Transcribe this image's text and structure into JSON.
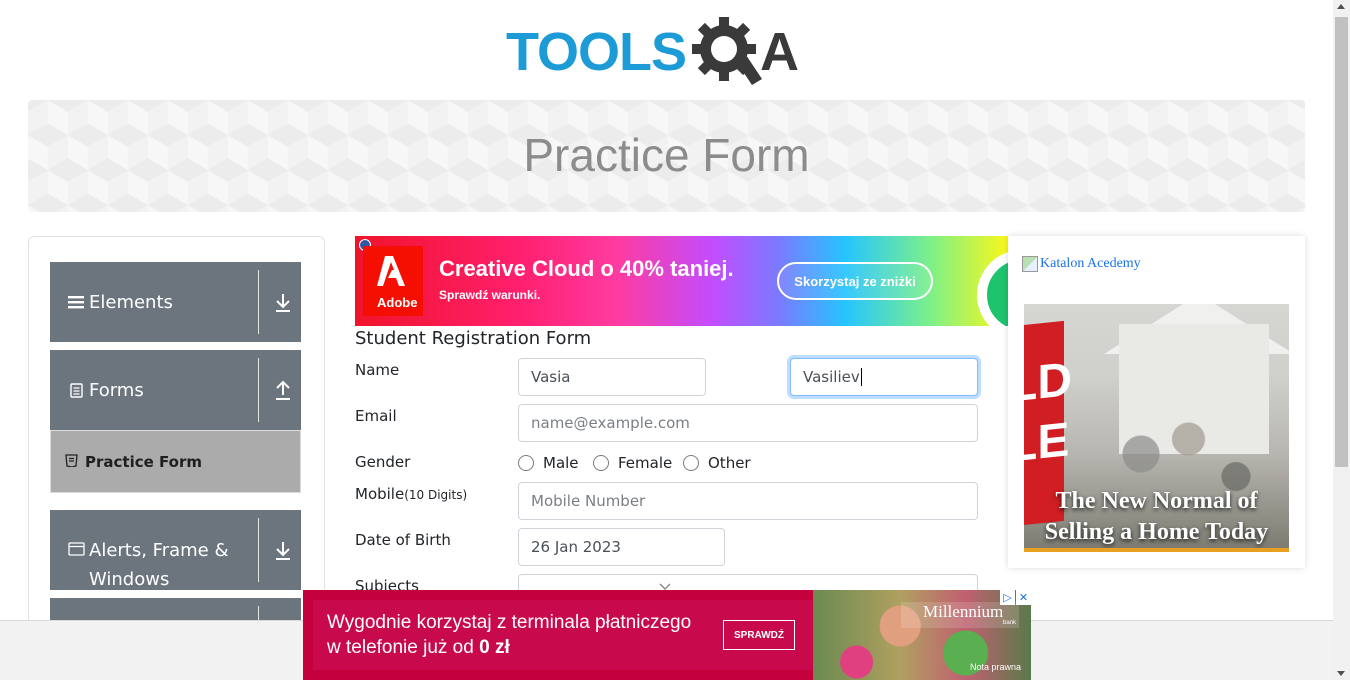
{
  "header": {
    "logo_text_left": "TOOLS",
    "logo_text_right": "A",
    "page_title": "Practice Form"
  },
  "sidebar": {
    "groups": [
      {
        "label": "Elements",
        "state": "collapsed"
      },
      {
        "label": "Forms",
        "state": "expanded"
      },
      {
        "label": "Alerts, Frame & Windows",
        "state": "collapsed"
      }
    ],
    "active_item": "Practice Form"
  },
  "ad_top": {
    "brand": "Adobe",
    "title": "Creative Cloud o 40% taniej.",
    "subtitle": "Sprawdź warunki.",
    "button": "Skorzystaj ze zniżki"
  },
  "form": {
    "title": "Student Registration Form",
    "labels": {
      "name": "Name",
      "email": "Email",
      "gender": "Gender",
      "mobile": "Mobile",
      "mobile_hint": "(10 Digits)",
      "dob": "Date of Birth",
      "subjects": "Subjects"
    },
    "first_name_value": "Vasia",
    "last_name_value": "Vasiliev",
    "email_placeholder": "name@example.com",
    "mobile_placeholder": "Mobile Number",
    "dob_value": "26 Jan 2023",
    "gender_options": [
      "Male",
      "Female",
      "Other"
    ]
  },
  "right_ad": {
    "link_text": "Katalon Acedemy",
    "caption_line1": "The New Normal of",
    "caption_line2": "Selling a Home Today",
    "sign_text": "LD\nLE"
  },
  "bottom_ad": {
    "text_line1": "Wygodnie korzystaj z terminala płatniczego",
    "text_line2_prefix": "w telefonie już od ",
    "text_line2_bold": "0 zł",
    "button": "SPRAWDŹ",
    "brand": "Millennium",
    "brand_sub": "bank",
    "note": "Nota prawna"
  },
  "colors": {
    "sidebar_header": "#6c757d",
    "active_item": "#ababab",
    "logo_blue": "#1d9bd7",
    "bottom_ad_bg": "#c4003d"
  }
}
